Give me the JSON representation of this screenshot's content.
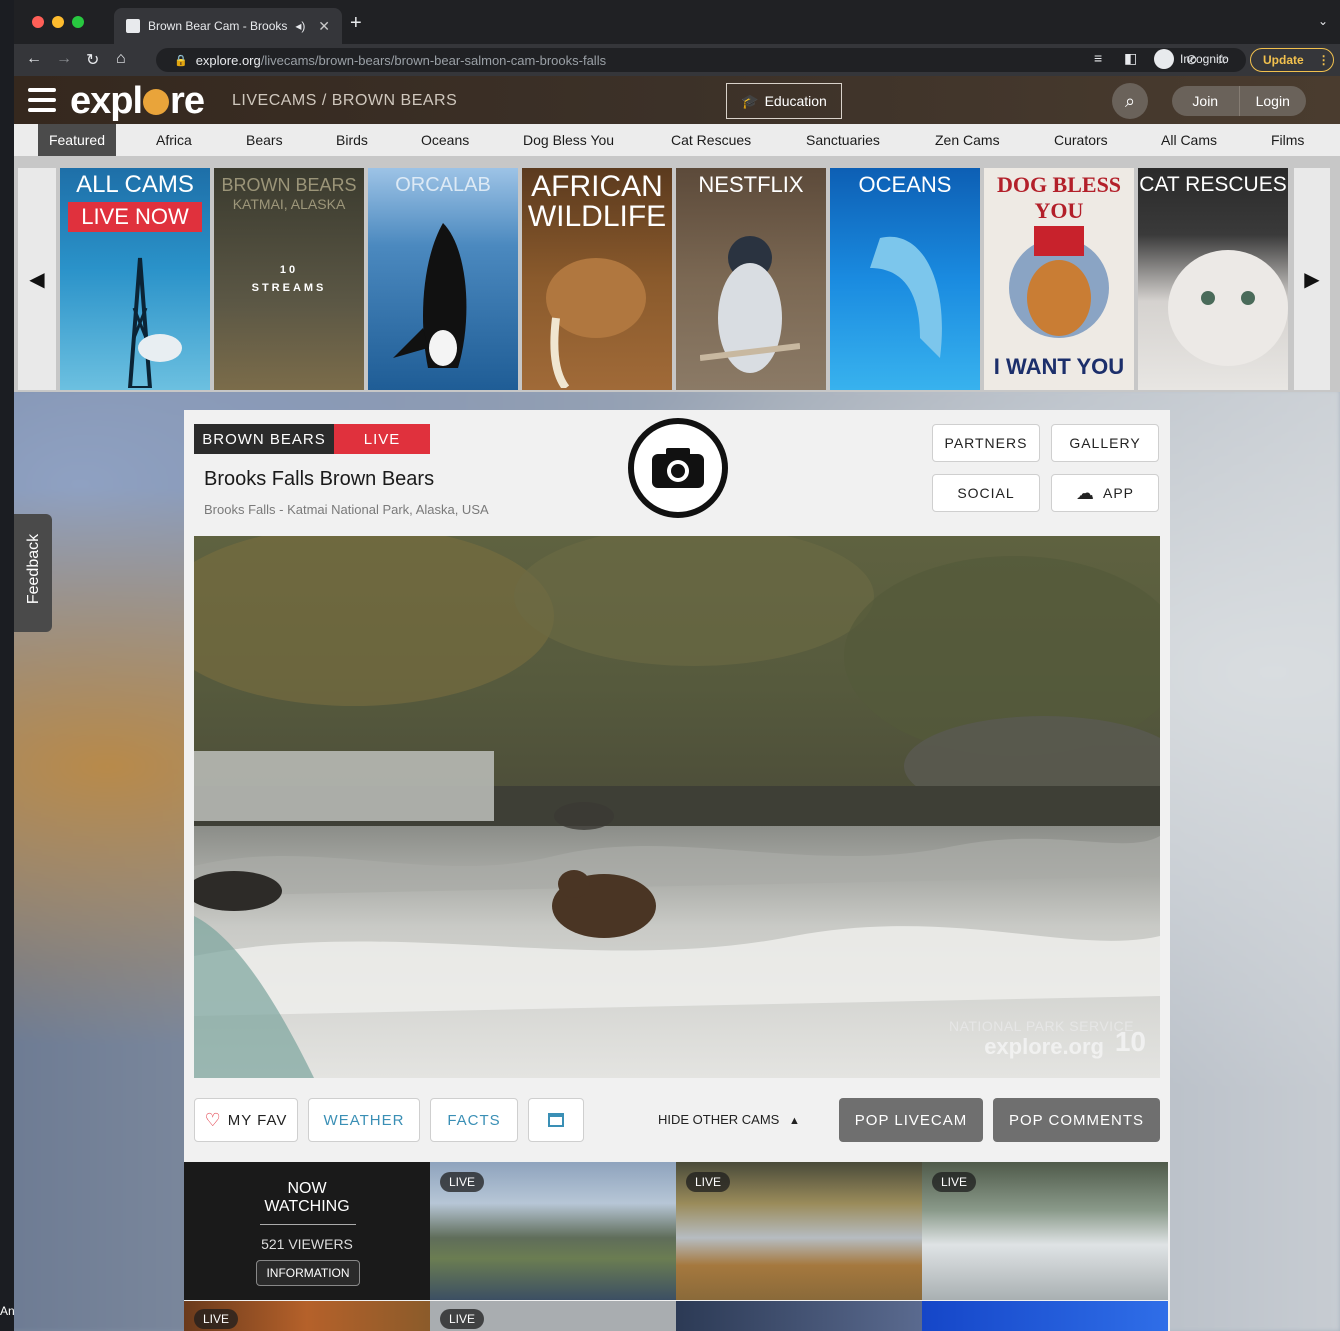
{
  "browser": {
    "tab_title": "Brown Bear Cam - Brooks",
    "new_tab_label": "+",
    "url_host": "explore.org",
    "url_path": "/livecams/brown-bears/brown-bear-salmon-cam-brooks-falls",
    "incognito_label": "Incognito",
    "update_label": "Update"
  },
  "header": {
    "logo": "explore",
    "breadcrumb": "LIVECAMS / BROWN BEARS",
    "education_label": "Education",
    "join_label": "Join",
    "login_label": "Login"
  },
  "nav": {
    "items": [
      "Featured",
      "Africa",
      "Bears",
      "Birds",
      "Oceans",
      "Dog Bless You",
      "Cat Rescues",
      "Sanctuaries",
      "Zen Cams",
      "Curators",
      "All Cams",
      "Films"
    ]
  },
  "carousel": {
    "tiles": [
      {
        "title": "ALL CAMS",
        "badge": "LIVE NOW"
      },
      {
        "title": "BROWN BEARS",
        "subtitle": "KATMAI, ALASKA",
        "streams": "10",
        "streams_label": "STREAMS"
      },
      {
        "title": "ORCALAB"
      },
      {
        "title": "AFRICAN WILDLIFE"
      },
      {
        "title": "NESTFLIX"
      },
      {
        "title": "OCEANS"
      },
      {
        "title": "DOG BLESS YOU",
        "footer": "I WANT YOU"
      },
      {
        "title": "CAT RESCUES"
      }
    ]
  },
  "player": {
    "category": "BROWN BEARS",
    "live": "LIVE",
    "title": "Brooks Falls Brown Bears",
    "location": "Brooks Falls - Katmai National Park, Alaska, USA",
    "partners": "PARTNERS",
    "gallery": "GALLERY",
    "social": "SOCIAL",
    "app": "APP",
    "watermark_nps": "NATIONAL PARK SERVICE",
    "watermark_site": "explore.org",
    "watermark_num": "10"
  },
  "controls": {
    "fav": "MY FAV",
    "weather": "WEATHER",
    "facts": "FACTS",
    "hide_cams": "HIDE OTHER CAMS",
    "pop_livecam": "POP LIVECAM",
    "pop_comments": "POP COMMENTS"
  },
  "now_watching": {
    "line1": "NOW",
    "line2": "WATCHING",
    "viewers": "521 VIEWERS",
    "info": "INFORMATION"
  },
  "thumb_live_label": "LIVE",
  "feedback_label": "Feedback",
  "corner_text": "An"
}
